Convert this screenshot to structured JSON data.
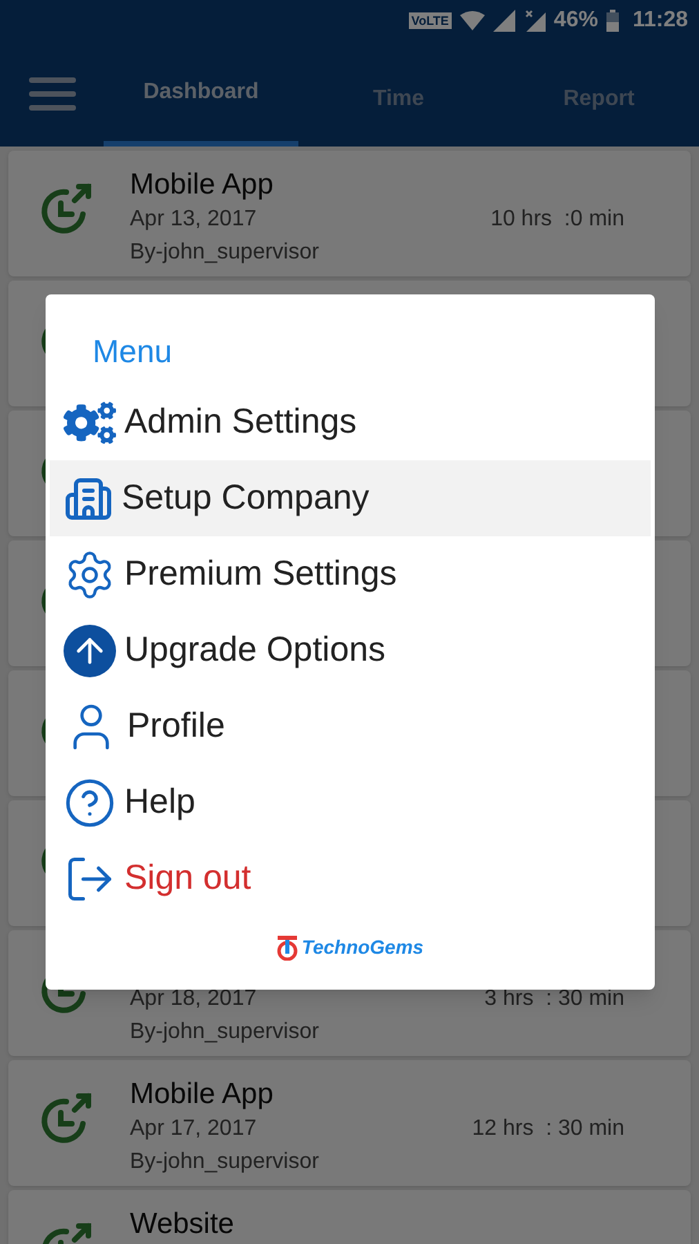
{
  "status_bar": {
    "network_badge": "VoLTE",
    "battery": "46%",
    "time": "11:28"
  },
  "tabs": [
    {
      "label": "Dashboard",
      "selected": true
    },
    {
      "label": "Time",
      "selected": false
    },
    {
      "label": "Report",
      "selected": false
    }
  ],
  "entries": [
    {
      "kind": "entry",
      "title": "Mobile App",
      "date": "Apr 13, 2017",
      "by": "By-john_supervisor",
      "duration": "10 hrs  :0 min"
    },
    {
      "kind": "hidden"
    },
    {
      "kind": "hidden"
    },
    {
      "kind": "hidden"
    },
    {
      "kind": "hidden"
    },
    {
      "kind": "hidden"
    },
    {
      "kind": "entry",
      "date": "Apr 18, 2017",
      "by": "By-john_supervisor",
      "duration": "3 hrs  : 30 min"
    },
    {
      "kind": "entry",
      "title": "Mobile App",
      "date": "Apr 17, 2017",
      "by": "By-john_supervisor",
      "duration": "12 hrs  : 30 min"
    },
    {
      "kind": "entry",
      "title": "Website"
    }
  ],
  "menu": {
    "title": "Menu",
    "items": [
      {
        "kind": "admin",
        "label": "Admin Settings",
        "selected": false
      },
      {
        "kind": "company",
        "label": "Setup Company",
        "selected": true
      },
      {
        "kind": "premium",
        "label": "Premium Settings",
        "selected": false
      },
      {
        "kind": "upgrade",
        "label": "Upgrade Options",
        "selected": false
      },
      {
        "kind": "profile",
        "label": "Profile",
        "selected": false
      },
      {
        "kind": "help",
        "label": "Help",
        "selected": false
      },
      {
        "kind": "signout",
        "label": "Sign out",
        "selected": false
      }
    ],
    "logo": "TechnoGems"
  }
}
